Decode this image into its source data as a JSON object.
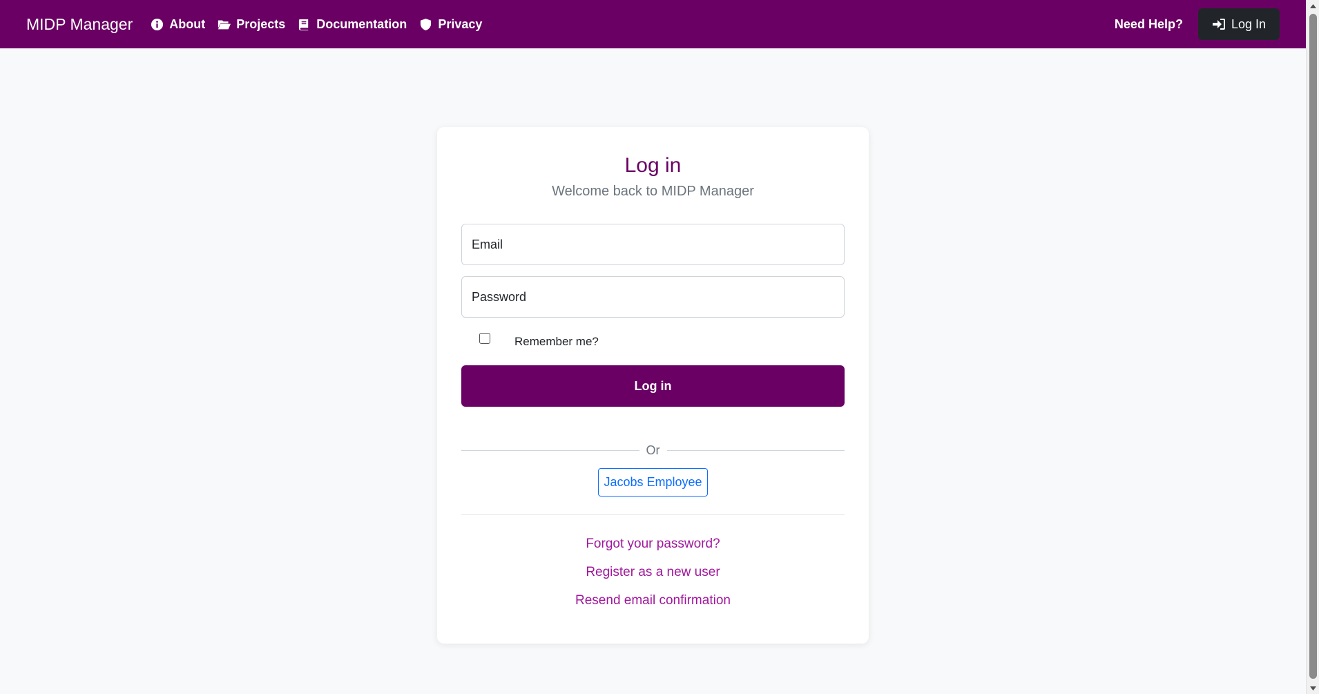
{
  "navbar": {
    "brand": "MIDP Manager",
    "links": [
      {
        "label": "About",
        "icon": "info-circle-icon"
      },
      {
        "label": "Projects",
        "icon": "folder-open-icon"
      },
      {
        "label": "Documentation",
        "icon": "book-icon"
      },
      {
        "label": "Privacy",
        "icon": "shield-icon"
      }
    ],
    "help": "Need Help?",
    "login": "Log In",
    "login_icon": "sign-in-icon"
  },
  "login_card": {
    "title": "Log in",
    "subtitle": "Welcome back to MIDP Manager",
    "email_placeholder": "Email",
    "password_placeholder": "Password",
    "remember_label": "Remember me?",
    "remember_checked": false,
    "submit_label": "Log in",
    "divider_text": "Or",
    "external_login": "Jacobs Employee",
    "links": {
      "forgot": "Forgot your password?",
      "register": "Register as a new user",
      "resend": "Resend email confirmation"
    }
  },
  "colors": {
    "brand": "#6a0064",
    "link": "#a0179b",
    "dark_button": "#212529",
    "outline_primary": "#0d6efd",
    "page_background": "#f8f9fa"
  }
}
